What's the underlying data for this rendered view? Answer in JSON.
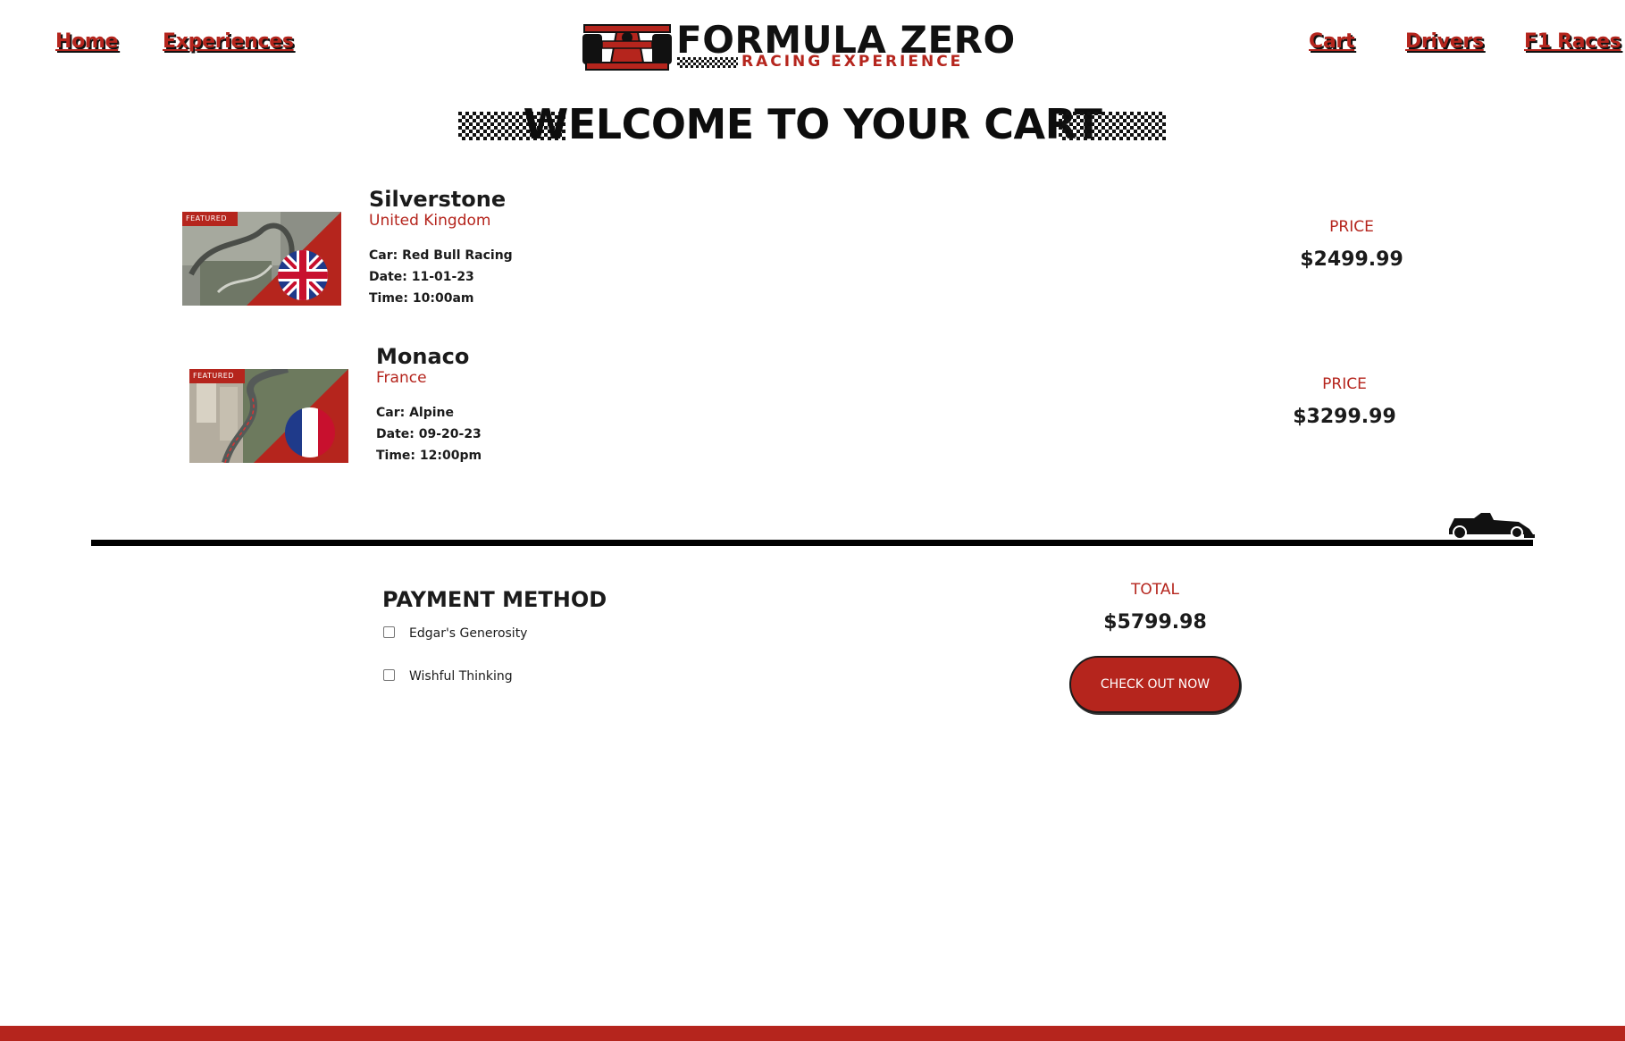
{
  "nav": {
    "home": "Home",
    "experiences": "Experiences",
    "cart": "Cart",
    "drivers": "Drivers",
    "f1_races": "F1 Races"
  },
  "logo": {
    "title": "FORMULA ZERO",
    "subtitle": "RACING EXPERIENCE"
  },
  "heading": "WELCOME TO YOUR CART",
  "items": [
    {
      "badge": "FEATURED",
      "name": "Silverstone",
      "country": "United Kingdom",
      "car": "Car: Red Bull Racing",
      "date": "Date: 11-01-23",
      "time": "Time: 10:00am",
      "price_label": "PRICE",
      "price": "$2499.99"
    },
    {
      "badge": "FEATURED",
      "name": "Monaco",
      "country": "France",
      "car": "Car: Alpine",
      "date": "Date: 09-20-23",
      "time": "Time: 12:00pm",
      "price_label": "PRICE",
      "price": "$3299.99"
    }
  ],
  "payment": {
    "title": "PAYMENT METHOD",
    "options": [
      {
        "label": "Edgar's Generosity",
        "checked": false
      },
      {
        "label": "Wishful Thinking",
        "checked": false
      }
    ]
  },
  "total": {
    "label": "TOTAL",
    "value": "$5799.98"
  },
  "checkout_label": "CHECK OUT NOW",
  "colors": {
    "brand_red": "#b5251d",
    "text_dark": "#1b1b1b",
    "background": "#ffffff"
  },
  "icons": [
    "race-car-logo-icon",
    "checkered-flag-icon",
    "race-car-icon",
    "union-jack-flag-icon",
    "french-flag-icon"
  ]
}
